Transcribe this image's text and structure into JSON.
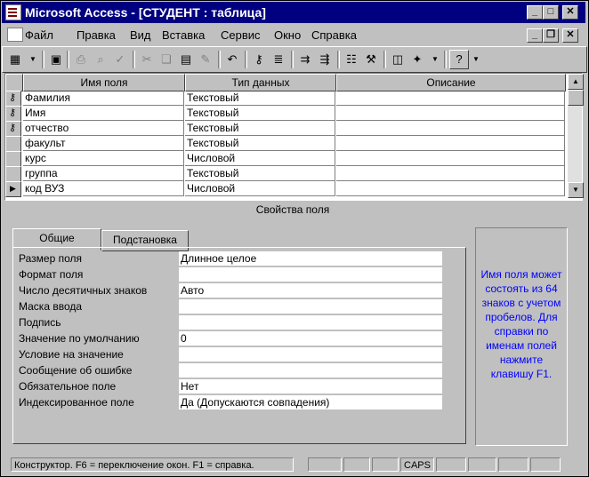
{
  "window": {
    "title": "Microsoft Access - [СТУДЕНТ : таблица]"
  },
  "menubar": {
    "items": [
      {
        "label": "Файл"
      },
      {
        "label": "Правка"
      },
      {
        "label": "Вид"
      },
      {
        "label": "Вставка"
      },
      {
        "label": "Сервис"
      },
      {
        "label": "Окно"
      },
      {
        "label": "Справка"
      }
    ]
  },
  "grid": {
    "headers": {
      "field": "Имя поля",
      "type": "Тип данных",
      "desc": "Описание"
    },
    "rows": [
      {
        "field": "Фамилия",
        "type": "Текстовый",
        "desc": "",
        "key": true
      },
      {
        "field": "Имя",
        "type": "Текстовый",
        "desc": "",
        "key": true
      },
      {
        "field": "отчество",
        "type": "Текстовый",
        "desc": "",
        "key": true
      },
      {
        "field": "факульт",
        "type": "Текстовый",
        "desc": ""
      },
      {
        "field": "курс",
        "type": "Числовой",
        "desc": ""
      },
      {
        "field": "группа",
        "type": "Текстовый",
        "desc": ""
      },
      {
        "field": "код ВУЗ",
        "type": "Числовой",
        "desc": "",
        "current": true
      }
    ]
  },
  "properties": {
    "title": "Свойства поля",
    "tabs": [
      {
        "label": "Общие"
      },
      {
        "label": "Подстановка"
      }
    ],
    "items": [
      {
        "label": "Размер поля",
        "value": "Длинное целое"
      },
      {
        "label": "Формат поля",
        "value": ""
      },
      {
        "label": "Число десятичных знаков",
        "value": "Авто"
      },
      {
        "label": "Маска ввода",
        "value": ""
      },
      {
        "label": "Подпись",
        "value": ""
      },
      {
        "label": "Значение по умолчанию",
        "value": "0"
      },
      {
        "label": "Условие на значение",
        "value": ""
      },
      {
        "label": "Сообщение об ошибке",
        "value": ""
      },
      {
        "label": "Обязательное поле",
        "value": "Нет"
      },
      {
        "label": "Индексированное поле",
        "value": "Да (Допускаются совпадения)"
      }
    ],
    "hint": "Имя поля может состоять из 64 знаков с учетом пробелов. Для справки по именам полей нажмите клавишу F1."
  },
  "statusbar": {
    "text": "Конструктор. F6 = переключение окон. F1 = справка.",
    "caps": "CAPS"
  },
  "colors": {
    "titlebar": "#000080",
    "hint_text": "#0000ff",
    "face": "#c0c0c0"
  }
}
